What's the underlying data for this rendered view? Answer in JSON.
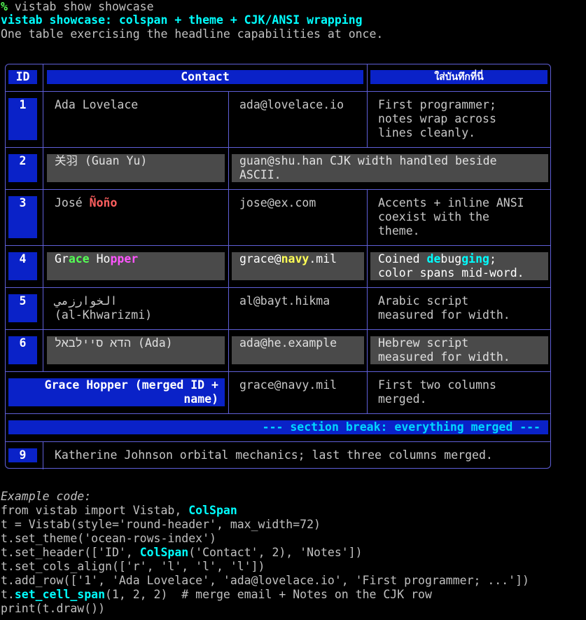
{
  "prompt": {
    "symbol": "%",
    "command": " vistab show showcase"
  },
  "title": "vistab showcase: colspan + theme + CJK/ANSI wrapping",
  "subtitle": "One table exercising the headline capabilities at once.",
  "table": {
    "headers": [
      "ID",
      "Contact",
      "ใส่บันทึกที่นี่"
    ],
    "rows": [
      {
        "id": "1",
        "name": [
          "Ada Lovelace"
        ],
        "email": "ada@lovelace.io",
        "notes": [
          "First programmer;",
          "notes wrap across",
          "lines cleanly."
        ]
      },
      {
        "id": "2",
        "name": [
          "关羽 (Guan Yu)"
        ],
        "span": [
          "guan@shu.han CJK width handled beside",
          "ASCII."
        ]
      },
      {
        "id": "3",
        "name_a": "José ",
        "name_b": "Ñoño",
        "email": "jose@ex.com",
        "notes": [
          "Accents + inline ANSI",
          "coexist with the",
          "theme."
        ]
      },
      {
        "id": "4",
        "name_parts": [
          "Gr",
          "ace",
          " Ho",
          "pper"
        ],
        "email_parts": [
          "grace@",
          "navy",
          ".mil"
        ],
        "notes_parts": [
          "Coined ",
          "de",
          "bug",
          "ging",
          ";"
        ],
        "notes2": "color spans mid-word."
      },
      {
        "id": "5",
        "name": [
          "الخوارزمي",
          "(al-Khwarizmi)"
        ],
        "email": "al@bayt.hikma",
        "notes": [
          "Arabic script",
          "measured for width."
        ]
      },
      {
        "id": "6",
        "name": [
          "הדא סיילבאל (Ada)"
        ],
        "email": "ada@he.example",
        "notes": [
          "Hebrew script",
          "measured for width."
        ]
      },
      {
        "merged": [
          "Grace Hopper (merged ID +",
          "name)"
        ],
        "email": "grace@navy.mil",
        "notes": [
          "First two columns",
          "merged."
        ]
      },
      {
        "section": "--- section break: everything merged ---"
      },
      {
        "id": "9",
        "span": "Katherine Johnson orbital mechanics; last three columns merged."
      }
    ]
  },
  "code": {
    "label": "Example code:",
    "line1a": "from vistab import Vistab, ",
    "line1b": "ColSpan",
    "line2": "t = Vistab(style='round-header', max_width=72)",
    "line3": "t.set_theme('ocean-rows-index')",
    "line4a": "t.set_header(['ID', ",
    "line4b": "ColSpan",
    "line4c": "('Contact', 2), 'Notes'])",
    "line5": "t.set_cols_align(['r', 'l', 'l', 'l'])",
    "line6": "t.add_row(['1', 'Ada Lovelace', 'ada@lovelace.io', 'First programmer; ...'])",
    "line7a": "t.",
    "line7b": "set_cell_span",
    "line7c": "(1, 2, 2)  # merge email + Notes on the CJK row",
    "line8": "print(t.draw())"
  }
}
